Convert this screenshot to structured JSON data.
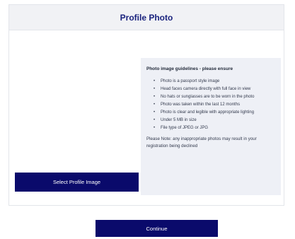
{
  "header": {
    "title": "Profile Photo"
  },
  "actions": {
    "select_label": "Select Profile Image",
    "continue_label": "Continue"
  },
  "guidelines": {
    "title": "Photo image guidelines - please ensure",
    "items": [
      "Photo is a passport style image",
      "Head faces camera directly with full face in view",
      "No hats or sunglasses are to be worn in the photo",
      "Photo was taken within the last 12 months",
      "Photo is clear and legible with appropriate lighting",
      "Under 5 MB in size",
      "File type of JPEG or JPG"
    ],
    "note": "Please Note: any inappropriate photos may result in your registration being declined"
  },
  "colors": {
    "primary_button": "#0a0a6b",
    "header_bg": "#f1f2f5",
    "title_text": "#1a237e",
    "guidelines_bg": "#eef0f6"
  }
}
